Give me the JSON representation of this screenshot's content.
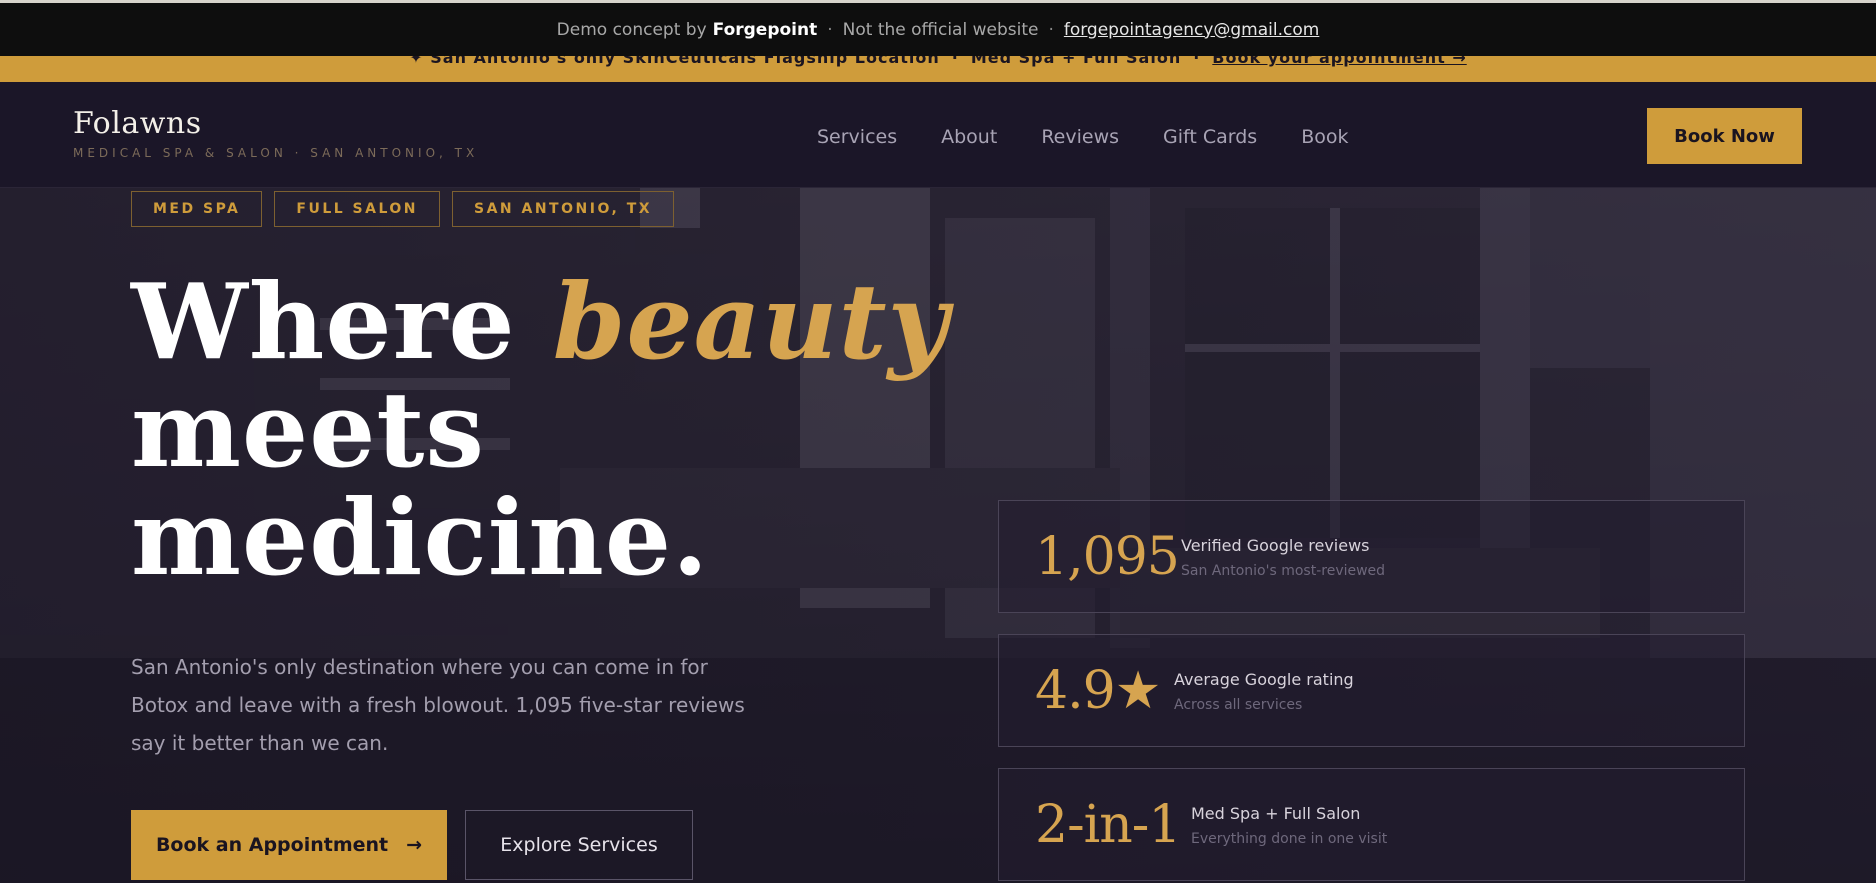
{
  "demo_bar": {
    "prefix": "Demo concept by",
    "brand": "Forgepoint",
    "separator": "·",
    "notice": "Not the official website",
    "email": "forgepointagency@gmail.com"
  },
  "announcement": {
    "lead": "✦ San Antonio's only SkinCeuticals Flagship Location",
    "sep": "·",
    "middle": "Med Spa + Full Salon",
    "cta": "Book your appointment →"
  },
  "header": {
    "logo_name": "Folawns",
    "logo_tagline": "MEDICAL SPA & SALON · SAN ANTONIO, TX",
    "nav": [
      "Services",
      "About",
      "Reviews",
      "Gift Cards",
      "Book"
    ],
    "book_now": "Book Now"
  },
  "hero": {
    "chips": [
      "MED SPA",
      "FULL SALON",
      "SAN ANTONIO, TX"
    ],
    "headline": {
      "line1_start": "Where ",
      "line1_accent": "beauty",
      "line2": "meets",
      "line3": "medicine."
    },
    "lede": "San Antonio's only destination where you can come in for Botox and leave with a fresh blowout. 1,095 five-star reviews say it better than we can.",
    "primary_cta": "Book an Appointment",
    "primary_cta_arrow": "→",
    "secondary_cta": "Explore Services",
    "stats": [
      {
        "value": "1,095",
        "label": "Verified Google reviews",
        "sub": "San Antonio's most-reviewed"
      },
      {
        "value": "4.9★",
        "label": "Average Google rating",
        "sub": "Across all services"
      },
      {
        "value": "2-in-1",
        "label": "Med Spa + Full Salon",
        "sub": "Everything done in one visit"
      }
    ]
  },
  "colors": {
    "gold": "#cf9c3b",
    "gold_text": "#d6a450",
    "header_bg": "#1b1628",
    "demo_bar_bg": "#0e0e0e"
  }
}
